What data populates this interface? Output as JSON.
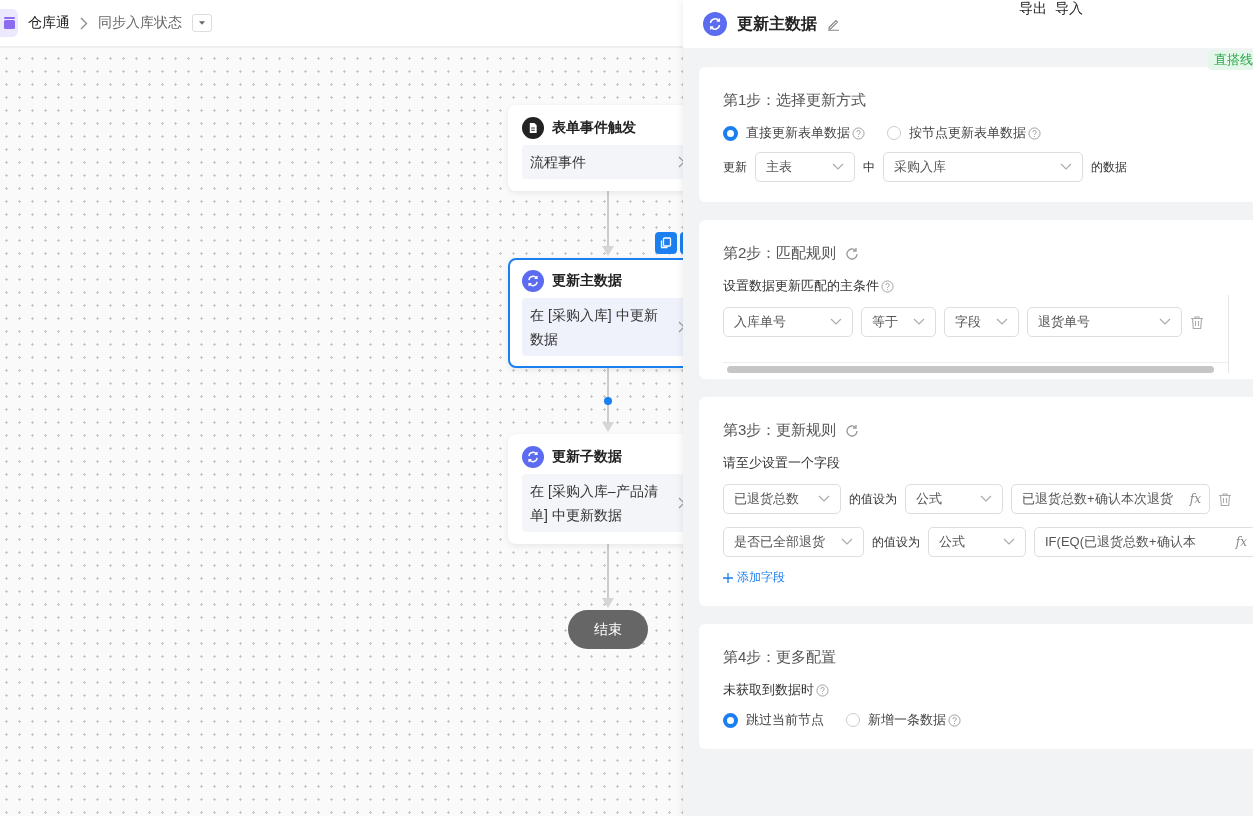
{
  "breadcrumb": {
    "app": "仓库通",
    "page": "同步入库状态"
  },
  "flow": {
    "nodes": [
      {
        "kind": "trigger",
        "title": "表单事件触发",
        "body": "流程事件",
        "selected": false
      },
      {
        "kind": "update",
        "title": "更新主数据",
        "body": "在 [采购入库] 中更新数据",
        "selected": true
      },
      {
        "kind": "update",
        "title": "更新子数据",
        "body": "在 [采购入库–产品清单] 中更新数据",
        "selected": false
      }
    ],
    "end": "结束"
  },
  "panel": {
    "title": "更新主数据",
    "header_links": [
      "导出",
      "导入"
    ],
    "tag": "直搭线",
    "step1": {
      "title": "第1步：选择更新方式",
      "radios": [
        {
          "label": "直接更新表单数据",
          "selected": true,
          "help": true
        },
        {
          "label": "按节点更新表单数据",
          "selected": false,
          "help": true
        }
      ],
      "row": {
        "prefix": "更新",
        "table": "主表",
        "middle": "中",
        "form": "采购入库",
        "suffix": "的数据"
      }
    },
    "step2": {
      "title": "第2步：匹配规则",
      "subtitle": "设置数据更新匹配的主条件",
      "help": true,
      "condition": {
        "field": "入库单号",
        "operator": "等于",
        "value_type": "字段",
        "value": "退货单号"
      }
    },
    "step3": {
      "title": "第3步：更新规则",
      "subtitle": "请至少设置一个字段",
      "rules": [
        {
          "field": "已退货总数",
          "label": "的值设为",
          "type": "公式",
          "formula": "已退货总数+确认本次退货",
          "formula_icon": "fx",
          "deletable": true
        },
        {
          "field": "是否已全部退货",
          "label": "的值设为",
          "type": "公式",
          "formula": "IF(EQ(已退货总数+确认本",
          "formula_icon": "fx",
          "deletable": false
        }
      ],
      "add": "添加字段"
    },
    "step4": {
      "title": "第4步：更多配置",
      "subtitle": "未获取到数据时",
      "help": true,
      "radios": [
        {
          "label": "跳过当前节点",
          "selected": true,
          "help": false
        },
        {
          "label": "新增一条数据",
          "selected": false,
          "help": true
        }
      ]
    }
  }
}
